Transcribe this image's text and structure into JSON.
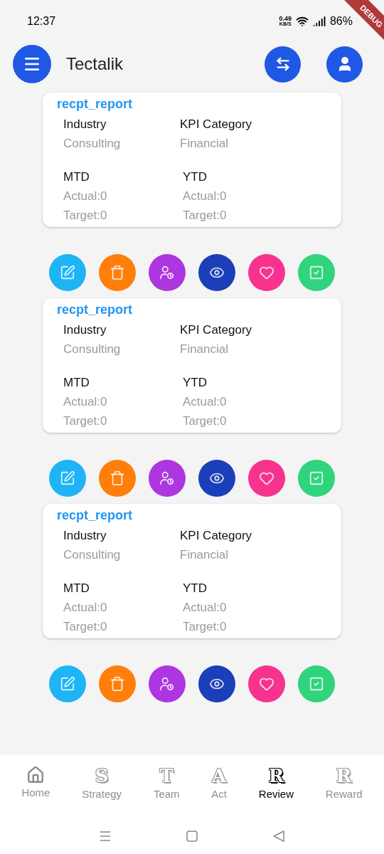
{
  "status_bar": {
    "time": "12:37",
    "net_speed": "0.49",
    "net_unit": "KB/S",
    "battery": "86%"
  },
  "debug_banner": "DEBUG",
  "app_bar": {
    "title": "Tectalik"
  },
  "cards": [
    {
      "title": "recpt_report",
      "industry_label": "Industry",
      "industry": "Consulting",
      "category_label": "KPI Category",
      "category": "Financial",
      "mtd_label": "MTD",
      "mtd_actual": "Actual:0",
      "mtd_target": "Target:0",
      "ytd_label": "YTD",
      "ytd_actual": "Actual:0",
      "ytd_target": "Target:0"
    },
    {
      "title": "recpt_report",
      "industry_label": "Industry",
      "industry": "Consulting",
      "category_label": "KPI Category",
      "category": "Financial",
      "mtd_label": "MTD",
      "mtd_actual": "Actual:0",
      "mtd_target": "Target:0",
      "ytd_label": "YTD",
      "ytd_actual": "Actual:0",
      "ytd_target": "Target:0"
    },
    {
      "title": "recpt_report",
      "industry_label": "Industry",
      "industry": "Consulting",
      "category_label": "KPI Category",
      "category": "Financial",
      "mtd_label": "MTD",
      "mtd_actual": "Actual:0",
      "mtd_target": "Target:0",
      "ytd_label": "YTD",
      "ytd_actual": "Actual:0",
      "ytd_target": "Target:0"
    }
  ],
  "actions": [
    {
      "kind": "edit",
      "color": "#1eb4f5"
    },
    {
      "kind": "delete",
      "color": "#ff7f0a"
    },
    {
      "kind": "assign",
      "color": "#ad36e0"
    },
    {
      "kind": "view",
      "color": "#1a3fb8"
    },
    {
      "kind": "favorite",
      "color": "#f7338f"
    },
    {
      "kind": "approve",
      "color": "#2fd47c"
    }
  ],
  "bottom_nav": [
    {
      "kind": "house",
      "label": "Home",
      "selected": false
    },
    {
      "kind": "letter",
      "letter": "S",
      "label": "Strategy",
      "selected": false
    },
    {
      "kind": "letter",
      "letter": "T",
      "label": "Team",
      "selected": false
    },
    {
      "kind": "letter",
      "letter": "A",
      "label": "Act",
      "selected": false
    },
    {
      "kind": "letter",
      "letter": "R",
      "label": "Review",
      "selected": true
    },
    {
      "kind": "letter",
      "letter": "R",
      "label": "Reward",
      "selected": false
    }
  ]
}
